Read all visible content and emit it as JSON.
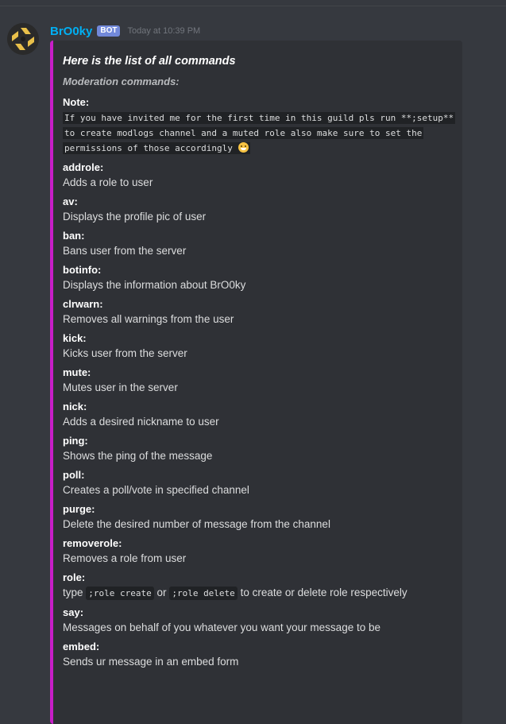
{
  "message": {
    "username": "BrO0ky",
    "bot_tag": "BOT",
    "timestamp": "Today at 10:39 PM",
    "avatar_icon": "ninjas-in-pyjamas-logo",
    "embed_color": "#c81ec8"
  },
  "embed": {
    "title": "Here is the list of all commands",
    "subtitle": "Moderation commands:",
    "note": {
      "name": "Note:",
      "lines": [
        "If you have invited me for the first time in this guild pls run **;setup**",
        "to create modlogs channel and a muted role also make sure to set the",
        "permissions of those accordingly"
      ],
      "emoji": "grinning-face-emoji"
    },
    "fields": [
      {
        "name": "addrole:",
        "value": "Adds a role to user"
      },
      {
        "name": "av:",
        "value": "Displays the profile pic of user"
      },
      {
        "name": "ban:",
        "value": "Bans user from the server"
      },
      {
        "name": "botinfo:",
        "value": "Displays the information about BrO0ky"
      },
      {
        "name": "clrwarn:",
        "value": "Removes all warnings from the user"
      },
      {
        "name": "kick:",
        "value": "Kicks user from the server"
      },
      {
        "name": "mute:",
        "value": "Mutes user in the server"
      },
      {
        "name": "nick:",
        "value": "Adds a desired nickname to user"
      },
      {
        "name": "ping:",
        "value": "Shows the ping of the message"
      },
      {
        "name": "poll:",
        "value": "Creates a poll/vote in specified channel"
      },
      {
        "name": "purge:",
        "value": "Delete the desired number of message from the channel"
      },
      {
        "name": "removerole:",
        "value": "Removes a role from user"
      }
    ],
    "role_field": {
      "name": "role:",
      "prefix": "type",
      "code1": ";role create",
      "middle": "or",
      "code2": ";role delete",
      "suffix": "to create or delete role respectively"
    },
    "tail_fields": [
      {
        "name": "say:",
        "value": "Messages on behalf of you whatever you want your message to be"
      },
      {
        "name": "embed:",
        "value": "Sends ur message in an embed form"
      }
    ]
  }
}
